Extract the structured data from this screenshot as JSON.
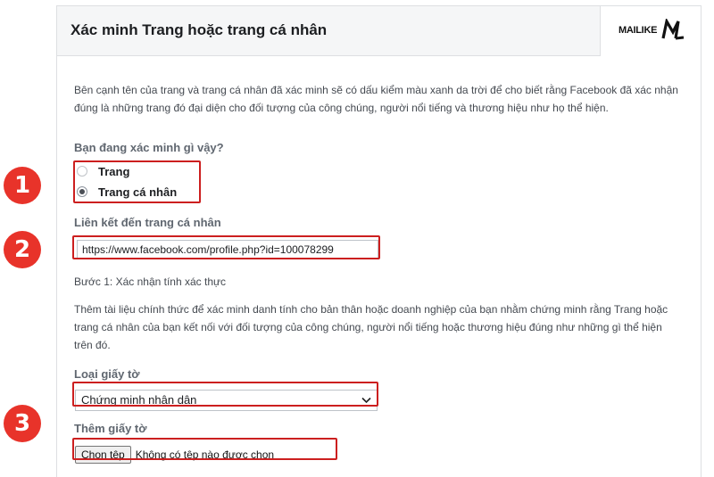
{
  "header": {
    "title": "Xác minh Trang hoặc trang cá nhân",
    "logo_text": "MAILIKE",
    "logo_icon": "ml-logo-mark"
  },
  "intro": "Bên cạnh tên của trang và trang cá nhân đã xác minh sẽ có dấu kiểm màu xanh da trời để cho biết rằng Facebook đã xác nhận đúng là những trang đó đại diện cho đối tượng của công chúng, người nổi tiếng và thương hiệu như họ thể hiện.",
  "verify_question": {
    "label": "Bạn đang xác minh gì vậy?",
    "options": [
      {
        "label": "Trang",
        "checked": false
      },
      {
        "label": "Trang cá nhân",
        "checked": true
      }
    ]
  },
  "profile_link": {
    "label": "Liên kết đến trang cá nhân",
    "value": "https://www.facebook.com/profile.php?id=100078299"
  },
  "step": "Bước 1: Xác nhận tính xác thực",
  "instructions": "Thêm tài liệu chính thức để xác minh danh tính cho bản thân hoặc doanh nghiệp của bạn nhằm chứng minh rằng Trang hoặc trang cá nhân của bạn kết nối với đối tượng của công chúng, người nổi tiếng hoặc thương hiệu đúng như những gì thể hiện trên đó.",
  "document_type": {
    "label": "Loại giấy tờ",
    "selected": "Chứng minh nhân dân"
  },
  "add_document": {
    "label": "Thêm giấy tờ",
    "button": "Chọn tệp",
    "status": "Không có tệp nào được chọn"
  },
  "badges": [
    "1",
    "2",
    "3"
  ],
  "colors": {
    "highlight": "#cc1f1f",
    "badge": "#e8332a",
    "header_bg": "#f5f6f7"
  }
}
